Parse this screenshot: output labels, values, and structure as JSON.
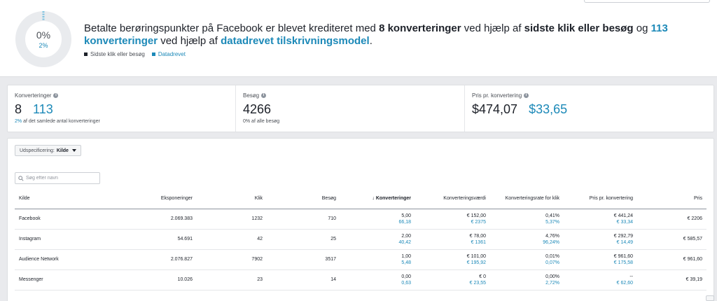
{
  "banner": {
    "donut_percent": "0%",
    "donut_subpercent": "2%",
    "headline_prefix": "Betalte berøringspunkter på Facebook er blevet krediteret med ",
    "headline_bold1": "8 konverteringer",
    "headline_mid1": " ved hjælp af ",
    "headline_bold2": "sidste klik eller besøg",
    "headline_mid2": " og ",
    "headline_blue1": "113 konverteringer",
    "headline_mid3": " ved hjælp af ",
    "headline_blue2": "datadrevet tilskrivningsmodel",
    "headline_end": ".",
    "legend": [
      {
        "label": "Sidste klik eller besøg",
        "color": "#1d2129"
      },
      {
        "label": "Datadrevet",
        "color": "#1c89b8"
      }
    ]
  },
  "metrics": {
    "conversions": {
      "label": "Konverteringer",
      "value_black": "8",
      "value_blue": "113",
      "sub_blue": "2%",
      "sub_rest": " af det samlede antal konverteringer"
    },
    "visits": {
      "label": "Besøg",
      "value": "4266",
      "sub": "0% af alle besøg"
    },
    "cost": {
      "label": "Pris pr. konvertering",
      "value_black": "$474,07",
      "value_blue": "$33,65"
    }
  },
  "breakdown": {
    "label": "Udspecificering:",
    "value": "Kilde"
  },
  "search": {
    "placeholder": "Søg efter navn"
  },
  "table": {
    "headers": [
      "Kilde",
      "Eksponeringer",
      "Klik",
      "Besøg",
      "↓ Konverteringer",
      "Konverteringsværdi",
      "Konverteringsrate for klik",
      "Pris pr. konvertering",
      "Pris"
    ],
    "rows": [
      {
        "source": "Facebook",
        "impressions": "2.069.383",
        "clicks": "1232",
        "visits": "710",
        "conv_a": "5,00",
        "conv_b": "66,18",
        "value_a": "€ 152,00",
        "value_b": "€ 2375",
        "rate_a": "0,41%",
        "rate_b": "5,37%",
        "cpc_a": "€ 441,24",
        "cpc_b": "€ 33,34",
        "price": "€ 2206"
      },
      {
        "source": "Instagram",
        "impressions": "54.691",
        "clicks": "42",
        "visits": "25",
        "conv_a": "2,00",
        "conv_b": "40,42",
        "value_a": "€ 78,00",
        "value_b": "€ 1361",
        "rate_a": "4,76%",
        "rate_b": "96,24%",
        "cpc_a": "€ 292,79",
        "cpc_b": "€ 14,49",
        "price": "€ 585,57"
      },
      {
        "source": "Audience Network",
        "impressions": "2.076.827",
        "clicks": "7902",
        "visits": "3517",
        "conv_a": "1,00",
        "conv_b": "5,48",
        "value_a": "€ 101,00",
        "value_b": "€ 195,92",
        "rate_a": "0,01%",
        "rate_b": "0,07%",
        "cpc_a": "€ 961,60",
        "cpc_b": "€ 175,58",
        "price": "€ 961,60"
      },
      {
        "source": "Messenger",
        "impressions": "10.026",
        "clicks": "23",
        "visits": "14",
        "conv_a": "0,00",
        "conv_b": "0,63",
        "value_a": "€ 0",
        "value_b": "€ 23,55",
        "rate_a": "0,00%",
        "rate_b": "2,72%",
        "cpc_a": "--",
        "cpc_b": "€ 62,60",
        "price": "€ 39,19"
      }
    ]
  },
  "colors": {
    "accent": "#1c89b8",
    "text": "#1d2129"
  }
}
